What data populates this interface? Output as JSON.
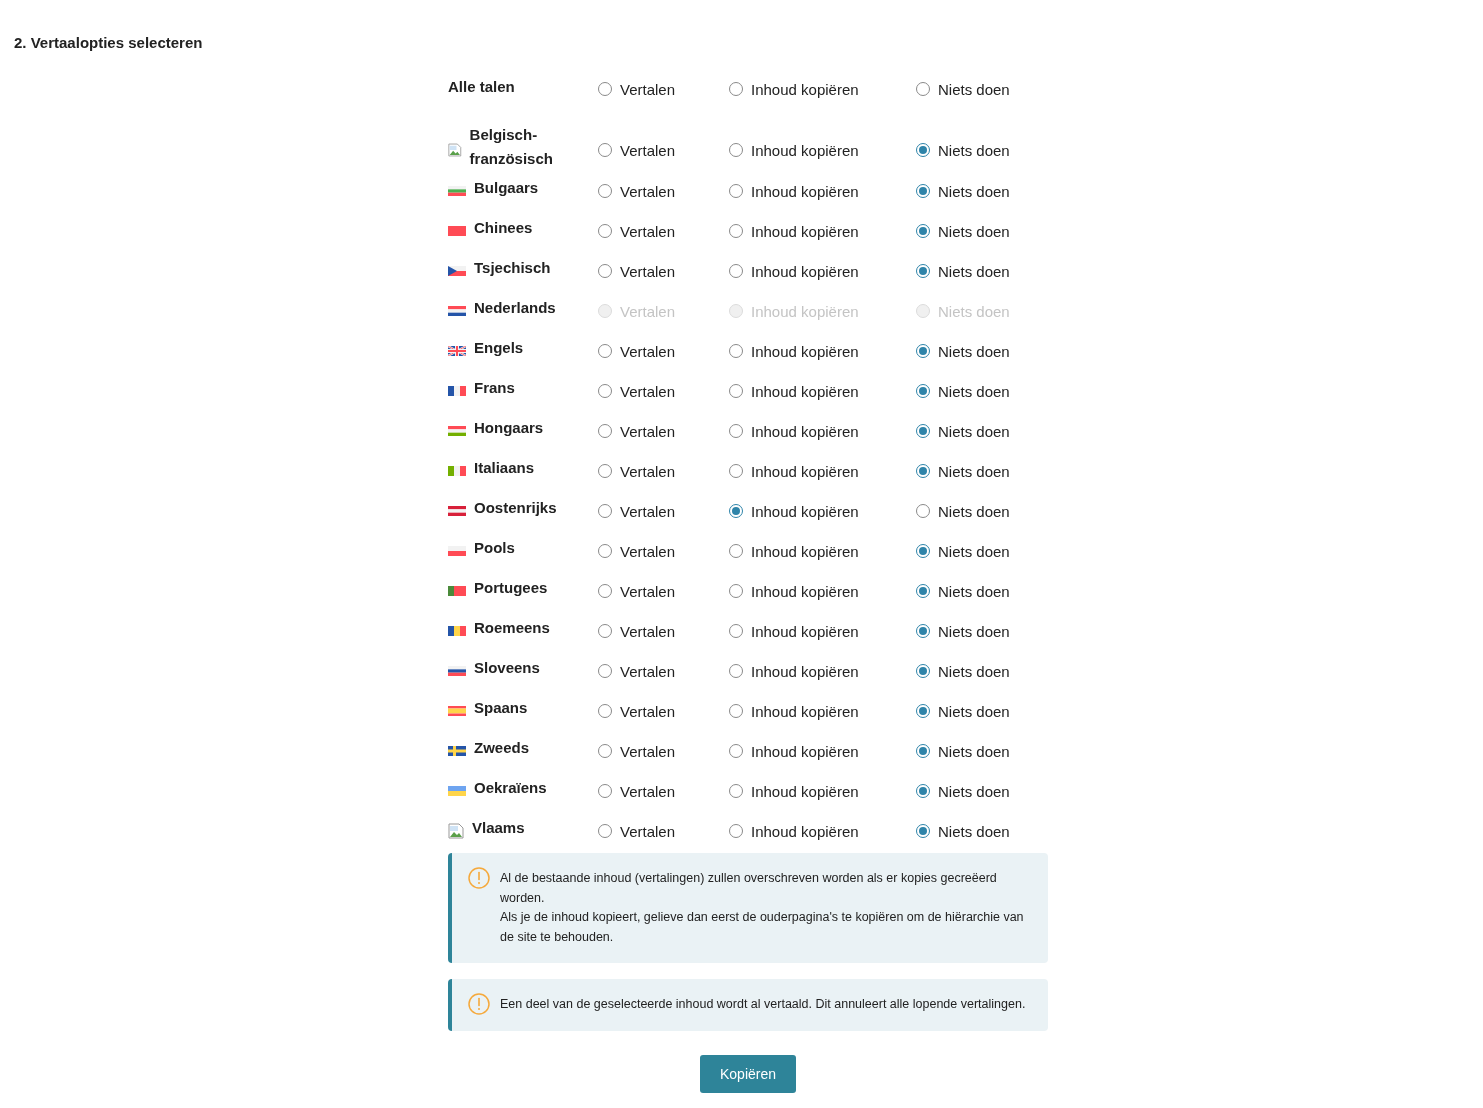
{
  "heading": "2. Vertaalopties selecteren",
  "all_languages": {
    "label": "Alle talen",
    "options": [
      {
        "label": "Vertalen",
        "selected": false
      },
      {
        "label": "Inhoud kopiëren",
        "selected": false
      },
      {
        "label": "Niets doen",
        "selected": false
      }
    ]
  },
  "rows": [
    {
      "language": "Belgisch-französisch",
      "flag": {
        "kind": "broken"
      },
      "disabled": false,
      "options": [
        {
          "label": "Vertalen",
          "selected": false
        },
        {
          "label": "Inhoud kopiëren",
          "selected": false
        },
        {
          "label": "Niets doen",
          "selected": true
        }
      ]
    },
    {
      "language": "Bulgaars",
      "flag": {
        "kind": "bulgaria"
      },
      "disabled": false,
      "options": [
        {
          "label": "Vertalen",
          "selected": false
        },
        {
          "label": "Inhoud kopiëren",
          "selected": false
        },
        {
          "label": "Niets doen",
          "selected": true
        }
      ]
    },
    {
      "language": "Chinees",
      "flag": {
        "kind": "china"
      },
      "disabled": false,
      "options": [
        {
          "label": "Vertalen",
          "selected": false
        },
        {
          "label": "Inhoud kopiëren",
          "selected": false
        },
        {
          "label": "Niets doen",
          "selected": true
        }
      ]
    },
    {
      "language": "Tsjechisch",
      "flag": {
        "kind": "czechia"
      },
      "disabled": false,
      "options": [
        {
          "label": "Vertalen",
          "selected": false
        },
        {
          "label": "Inhoud kopiëren",
          "selected": false
        },
        {
          "label": "Niets doen",
          "selected": true
        }
      ]
    },
    {
      "language": "Nederlands",
      "flag": {
        "kind": "netherlands"
      },
      "disabled": true,
      "options": [
        {
          "label": "Vertalen",
          "selected": false
        },
        {
          "label": "Inhoud kopiëren",
          "selected": false
        },
        {
          "label": "Niets doen",
          "selected": false
        }
      ]
    },
    {
      "language": "Engels",
      "flag": {
        "kind": "uk"
      },
      "disabled": false,
      "options": [
        {
          "label": "Vertalen",
          "selected": false
        },
        {
          "label": "Inhoud kopiëren",
          "selected": false
        },
        {
          "label": "Niets doen",
          "selected": true
        }
      ]
    },
    {
      "language": "Frans",
      "flag": {
        "kind": "france"
      },
      "disabled": false,
      "options": [
        {
          "label": "Vertalen",
          "selected": false
        },
        {
          "label": "Inhoud kopiëren",
          "selected": false
        },
        {
          "label": "Niets doen",
          "selected": true
        }
      ]
    },
    {
      "language": "Hongaars",
      "flag": {
        "kind": "hungary"
      },
      "disabled": false,
      "options": [
        {
          "label": "Vertalen",
          "selected": false
        },
        {
          "label": "Inhoud kopiëren",
          "selected": false
        },
        {
          "label": "Niets doen",
          "selected": true
        }
      ]
    },
    {
      "language": "Italiaans",
      "flag": {
        "kind": "italy"
      },
      "disabled": false,
      "options": [
        {
          "label": "Vertalen",
          "selected": false
        },
        {
          "label": "Inhoud kopiëren",
          "selected": false
        },
        {
          "label": "Niets doen",
          "selected": true
        }
      ]
    },
    {
      "language": "Oostenrijks",
      "flag": {
        "kind": "austria"
      },
      "disabled": false,
      "options": [
        {
          "label": "Vertalen",
          "selected": false
        },
        {
          "label": "Inhoud kopiëren",
          "selected": true
        },
        {
          "label": "Niets doen",
          "selected": false
        }
      ]
    },
    {
      "language": "Pools",
      "flag": {
        "kind": "poland"
      },
      "disabled": false,
      "options": [
        {
          "label": "Vertalen",
          "selected": false
        },
        {
          "label": "Inhoud kopiëren",
          "selected": false
        },
        {
          "label": "Niets doen",
          "selected": true
        }
      ]
    },
    {
      "language": "Portugees",
      "flag": {
        "kind": "portugal"
      },
      "disabled": false,
      "options": [
        {
          "label": "Vertalen",
          "selected": false
        },
        {
          "label": "Inhoud kopiëren",
          "selected": false
        },
        {
          "label": "Niets doen",
          "selected": true
        }
      ]
    },
    {
      "language": "Roemeens",
      "flag": {
        "kind": "romania"
      },
      "disabled": false,
      "options": [
        {
          "label": "Vertalen",
          "selected": false
        },
        {
          "label": "Inhoud kopiëren",
          "selected": false
        },
        {
          "label": "Niets doen",
          "selected": true
        }
      ]
    },
    {
      "language": "Sloveens",
      "flag": {
        "kind": "slovenia"
      },
      "disabled": false,
      "options": [
        {
          "label": "Vertalen",
          "selected": false
        },
        {
          "label": "Inhoud kopiëren",
          "selected": false
        },
        {
          "label": "Niets doen",
          "selected": true
        }
      ]
    },
    {
      "language": "Spaans",
      "flag": {
        "kind": "spain"
      },
      "disabled": false,
      "options": [
        {
          "label": "Vertalen",
          "selected": false
        },
        {
          "label": "Inhoud kopiëren",
          "selected": false
        },
        {
          "label": "Niets doen",
          "selected": true
        }
      ]
    },
    {
      "language": "Zweeds",
      "flag": {
        "kind": "sweden"
      },
      "disabled": false,
      "options": [
        {
          "label": "Vertalen",
          "selected": false
        },
        {
          "label": "Inhoud kopiëren",
          "selected": false
        },
        {
          "label": "Niets doen",
          "selected": true
        }
      ]
    },
    {
      "language": "Oekraïens",
      "flag": {
        "kind": "ukraine"
      },
      "disabled": false,
      "options": [
        {
          "label": "Vertalen",
          "selected": false
        },
        {
          "label": "Inhoud kopiëren",
          "selected": false
        },
        {
          "label": "Niets doen",
          "selected": true
        }
      ]
    },
    {
      "language": "Vlaams",
      "flag": {
        "kind": "broken"
      },
      "disabled": false,
      "options": [
        {
          "label": "Vertalen",
          "selected": false
        },
        {
          "label": "Inhoud kopiëren",
          "selected": false
        },
        {
          "label": "Niets doen",
          "selected": true
        }
      ]
    }
  ],
  "alerts": [
    {
      "lines": [
        "Al de bestaande inhoud (vertalingen) zullen overschreven worden als er kopies gecreëerd worden.",
        "Als je de inhoud kopieert, gelieve dan eerst de ouderpagina's te kopiëren om de hiërarchie van de site te behouden."
      ]
    },
    {
      "lines": [
        "Een deel van de geselecteerde inhoud wordt al vertaald. Dit annuleert alle lopende vertalingen."
      ]
    }
  ],
  "button": "Kopiëren"
}
